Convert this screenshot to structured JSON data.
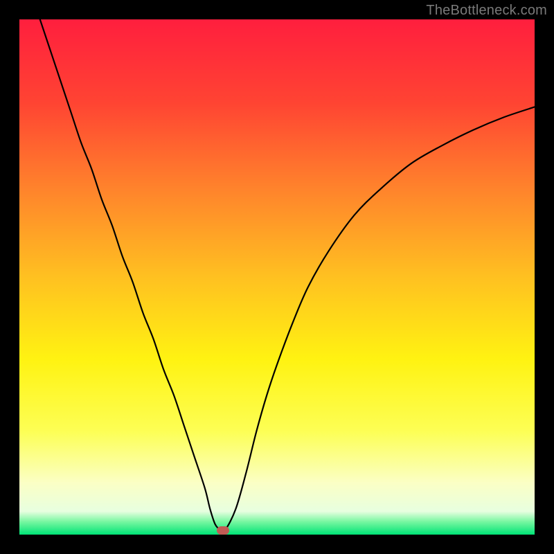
{
  "watermark": "TheBottleneck.com",
  "chart_data": {
    "type": "line",
    "title": "",
    "xlabel": "",
    "ylabel": "",
    "xlim": [
      0,
      100
    ],
    "ylim": [
      0,
      100
    ],
    "grid": false,
    "legend": false,
    "background_gradient": {
      "stops": [
        {
          "pos": 0.0,
          "color": "#ff1f3e"
        },
        {
          "pos": 0.16,
          "color": "#ff4433"
        },
        {
          "pos": 0.33,
          "color": "#ff842c"
        },
        {
          "pos": 0.5,
          "color": "#ffc121"
        },
        {
          "pos": 0.66,
          "color": "#fff312"
        },
        {
          "pos": 0.8,
          "color": "#fdff56"
        },
        {
          "pos": 0.9,
          "color": "#fbffc6"
        },
        {
          "pos": 0.955,
          "color": "#e8ffe0"
        },
        {
          "pos": 0.975,
          "color": "#78f7a1"
        },
        {
          "pos": 1.0,
          "color": "#00e477"
        }
      ]
    },
    "series": [
      {
        "name": "bottleneck-curve",
        "color": "#000000",
        "x": [
          4,
          6,
          8,
          10,
          12,
          14,
          16,
          18,
          20,
          22,
          24,
          26,
          28,
          30,
          32,
          34,
          36,
          37,
          38,
          39,
          40,
          42,
          44,
          46,
          48,
          50,
          53,
          56,
          60,
          65,
          70,
          76,
          82,
          88,
          94,
          100
        ],
        "y": [
          100,
          94,
          88,
          82,
          76,
          71,
          65,
          60,
          54,
          49,
          43,
          38,
          32,
          27,
          21,
          15,
          9,
          5,
          2,
          1,
          1,
          5,
          12,
          20,
          27,
          33,
          41,
          48,
          55,
          62,
          67,
          72,
          75.5,
          78.5,
          81,
          83
        ]
      }
    ],
    "annotations": [
      {
        "type": "marker",
        "shape": "rounded-rect",
        "color": "#c15b55",
        "x": 39.5,
        "y": 0.8
      }
    ]
  }
}
